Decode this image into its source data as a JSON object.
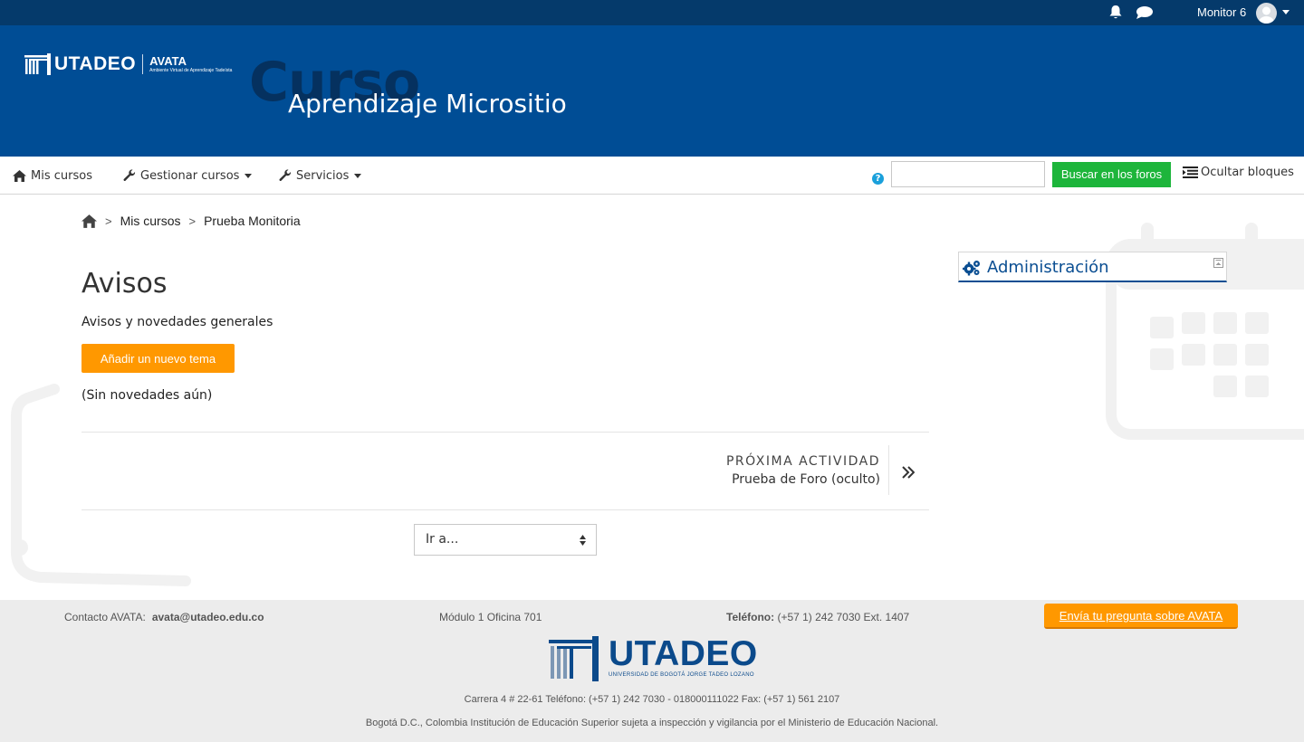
{
  "topbar": {
    "user_name": "Monitor 6"
  },
  "header": {
    "logo_text": "UTADEO",
    "logo_product": "AVATA",
    "logo_product_sub": "Ambiente Virtual de Aprendizaje Tadeísta",
    "ghost_text": "Curso",
    "course_title": "Aprendizaje Micrositio"
  },
  "nav": {
    "my_courses": "Mis cursos",
    "manage_courses": "Gestionar cursos",
    "services": "Servicios",
    "search_value": "",
    "search_button": "Buscar en los foros",
    "help": "?",
    "hide_blocks": "Ocultar bloques"
  },
  "breadcrumb": {
    "items": [
      "Mis cursos",
      "Prueba Monitoria"
    ],
    "separator": ">"
  },
  "main": {
    "title": "Avisos",
    "subtitle": "Avisos y novedades generales",
    "add_topic_button": "Añadir un nuevo tema",
    "empty_note": "(Sin novedades aún)",
    "next_activity_label": "PRÓXIMA ACTIVIDAD",
    "next_activity_link": "Prueba de Foro (oculto)",
    "jump_select": "Ir a..."
  },
  "admin_block": {
    "title": "Administración"
  },
  "footer": {
    "contact_label": "Contacto AVATA:",
    "contact_email": "avata@utadeo.edu.co",
    "office": "Módulo 1 Oficina 701",
    "phone_label": "Teléfono:",
    "phone_value": " (+57 1) 242 7030 Ext. 1407",
    "ask_button": "Envía tu pregunta sobre AVATA",
    "logo_text": "UTADEO",
    "logo_sub": "UNIVERSIDAD DE BOGOTÁ JORGE TADEO LOZANO",
    "address": "Carrera 4 # 22-61 Teléfono: (+57 1) 242 7030 - 018000111022 Fax: (+57 1) 561 2107",
    "legal": "Bogotá D.C., Colombia Institución de Educación Superior sujeta a inspección y vigilancia por el Ministerio de Educación Nacional."
  },
  "colors": {
    "topbar": "#053a6b",
    "banner": "#004d95",
    "accent_orange": "#ff9800",
    "search_green": "#1db53b",
    "admin_blue": "#0a4e92",
    "footer_bg": "#ececec"
  }
}
